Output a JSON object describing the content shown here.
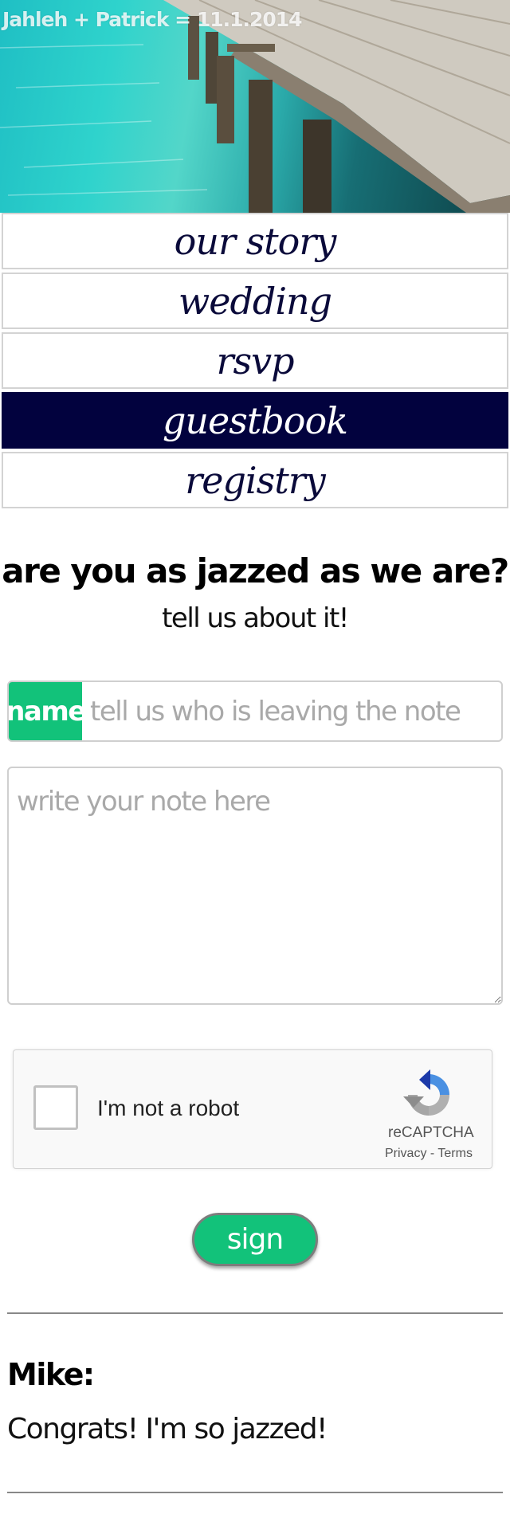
{
  "header": {
    "title": "Jahleh + Patrick = 11.1.2014"
  },
  "nav": {
    "items": [
      {
        "label": "our story",
        "active": false
      },
      {
        "label": "wedding",
        "active": false
      },
      {
        "label": "rsvp",
        "active": false
      },
      {
        "label": "guestbook",
        "active": true
      },
      {
        "label": "registry",
        "active": false
      }
    ]
  },
  "guestbook": {
    "heading": "are you as jazzed as we are?",
    "subheading": "tell us about it!",
    "name_label": "name",
    "name_placeholder": "tell us who is leaving the note",
    "name_value": "",
    "note_placeholder": "write your note here",
    "note_value": "",
    "sign_label": "sign"
  },
  "captcha": {
    "label": "I'm not a robot",
    "checked": false,
    "brand": "reCAPTCHA",
    "privacy": "Privacy",
    "separator": " - ",
    "terms": "Terms"
  },
  "entries": [
    {
      "name": "Mike:",
      "message": "Congrats! I'm so jazzed!"
    }
  ],
  "colors": {
    "accent_green": "#12c27a",
    "nav_active": "#02023e",
    "nav_text": "#0a0a3a"
  },
  "icons": [
    "checkbox-icon",
    "recaptcha-logo-icon"
  ]
}
